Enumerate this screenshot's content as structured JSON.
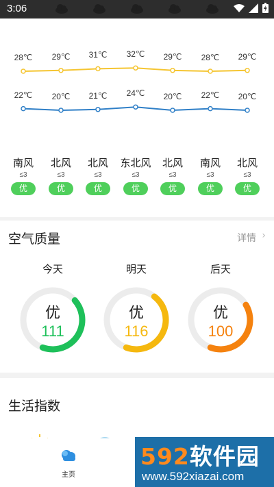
{
  "status_bar": {
    "time": "3:06"
  },
  "trend": {
    "high_temps": [
      "28℃",
      "29℃",
      "31℃",
      "32℃",
      "29℃",
      "28℃",
      "29℃"
    ],
    "low_temps": [
      "22℃",
      "20℃",
      "21℃",
      "24℃",
      "20℃",
      "22℃",
      "20℃"
    ],
    "high_values": [
      28,
      29,
      31,
      32,
      29,
      28,
      29
    ],
    "low_values": [
      22,
      20,
      21,
      24,
      20,
      22,
      20
    ],
    "high_color": "#f5c531",
    "low_color": "#2f7fc7",
    "winds": [
      {
        "direction": "南风",
        "level": "≤3",
        "aqi": "优"
      },
      {
        "direction": "北风",
        "level": "≤3",
        "aqi": "优"
      },
      {
        "direction": "北风",
        "level": "≤3",
        "aqi": "优"
      },
      {
        "direction": "东北风",
        "level": "≤3",
        "aqi": "优"
      },
      {
        "direction": "北风",
        "level": "≤3",
        "aqi": "优"
      },
      {
        "direction": "南风",
        "level": "≤3",
        "aqi": "优"
      },
      {
        "direction": "北风",
        "level": "≤3",
        "aqi": "优"
      }
    ]
  },
  "air_quality": {
    "title": "空气质量",
    "detail_label": "详情",
    "days": [
      {
        "day": "今天",
        "level": "优",
        "value": "111",
        "fraction": 0.42,
        "color": "#1ec05a"
      },
      {
        "day": "明天",
        "level": "优",
        "value": "116",
        "fraction": 0.45,
        "color": "#f5b80f"
      },
      {
        "day": "后天",
        "level": "优",
        "value": "100",
        "fraction": 0.39,
        "color": "#f5820f"
      }
    ]
  },
  "life_index": {
    "title": "生活指数",
    "icons": [
      "sun-icon",
      "mountain-icon",
      "grid-icon",
      "drop-icon"
    ]
  },
  "tab_bar": {
    "home_label": "主页",
    "home_icon": "cloud-icon"
  },
  "watermark": {
    "brand": "592软件园",
    "url": "www.592xiazai.com"
  }
}
